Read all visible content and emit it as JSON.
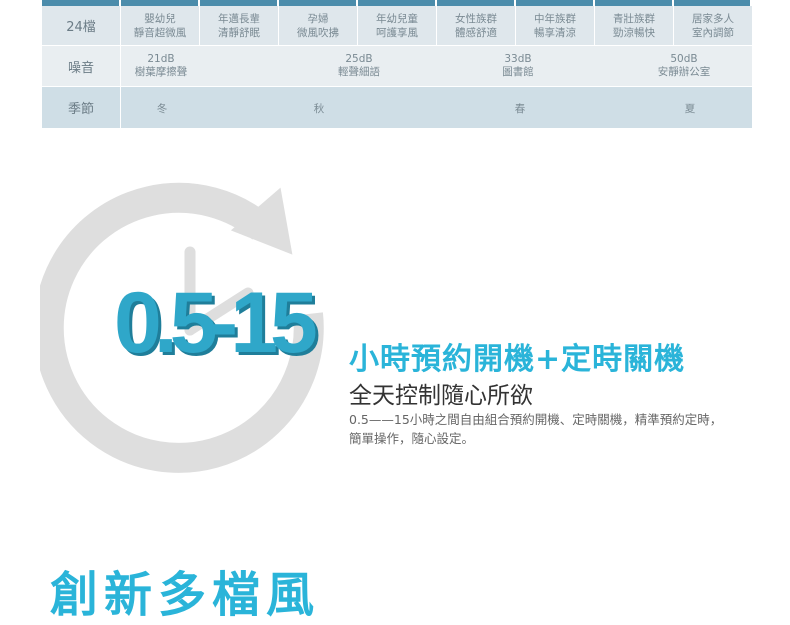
{
  "table": {
    "row1": {
      "header": "24檔",
      "cells": [
        [
          "嬰幼兒",
          "靜音超微風"
        ],
        [
          "年邁長輩",
          "清靜舒眠"
        ],
        [
          "孕婦",
          "微風吹拂"
        ],
        [
          "年幼兒童",
          "呵護享風"
        ],
        [
          "女性族群",
          "體感舒適"
        ],
        [
          "中年族群",
          "暢享清涼"
        ],
        [
          "青壯族群",
          "勁涼暢快"
        ],
        [
          "居家多人",
          "室內調節"
        ]
      ]
    },
    "row2": {
      "header": "噪音",
      "items": [
        {
          "db": "21dB",
          "desc": "樹葉摩擦聲"
        },
        {
          "db": "25dB",
          "desc": "輕聲細語"
        },
        {
          "db": "33dB",
          "desc": "圖書館"
        },
        {
          "db": "50dB",
          "desc": "安靜辦公室"
        }
      ]
    },
    "row3": {
      "header": "季節",
      "items": [
        "冬",
        "秋",
        "春",
        "夏"
      ]
    }
  },
  "timer": {
    "big_number": "0.5-15",
    "headline": "小時預約開機+定時關機",
    "subhead": "全天控制隨心所欲",
    "description": "0.5——15小時之間自由組合預約開機、定時關機，精準預約定時，簡單操作，隨心設定。"
  },
  "next_section": {
    "title": "創新多檔風"
  },
  "colors": {
    "accent": "#2ab4d9",
    "table_bar": "#4b8cab",
    "clock_gray": "#dedede"
  },
  "icons": [
    "clock-arrow-icon"
  ]
}
